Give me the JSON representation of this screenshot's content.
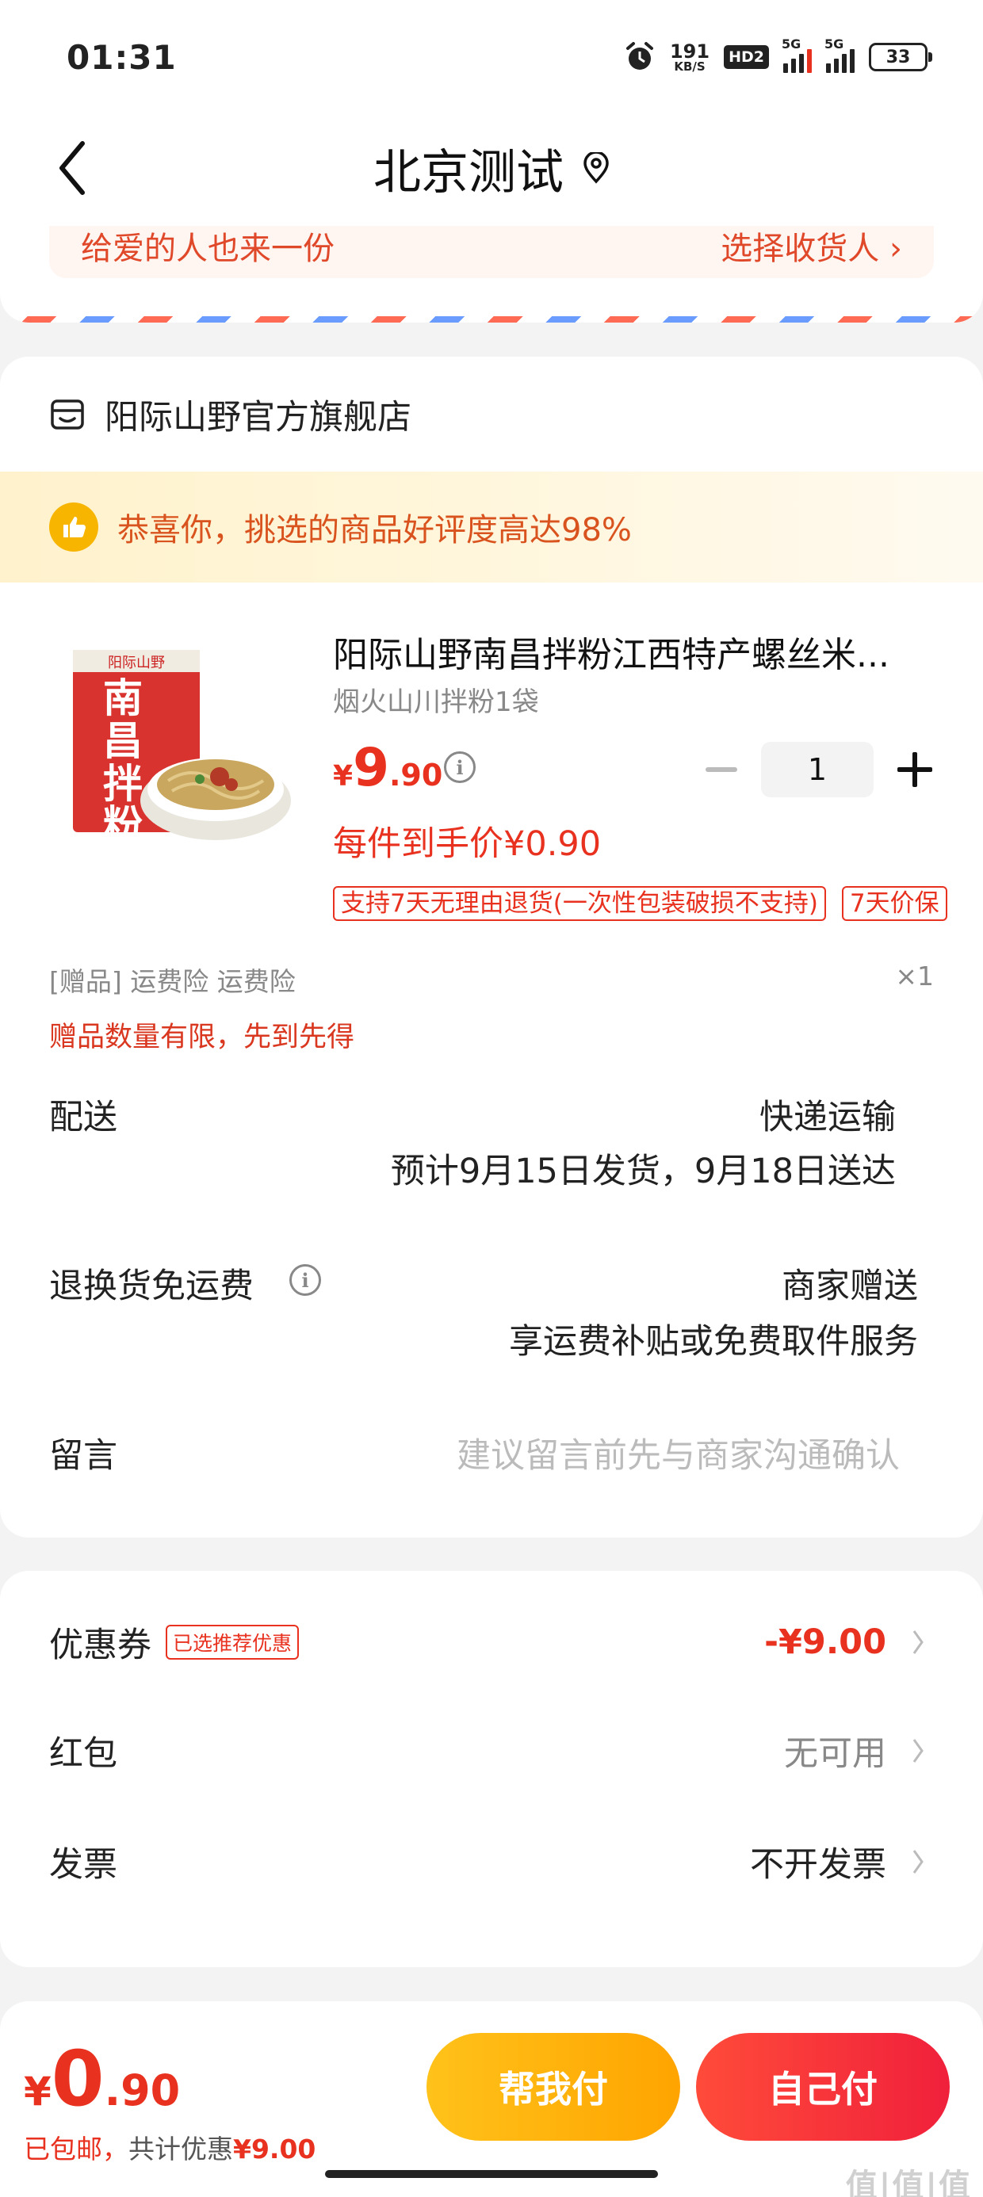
{
  "status": {
    "time": "01:31",
    "net_speed_value": "191",
    "net_speed_unit": "KB/S",
    "hd_label": "HD2",
    "signal1_label": "5G",
    "signal2_label": "5G",
    "battery": "33"
  },
  "nav": {
    "title": "北京测试"
  },
  "address": {
    "left_text": "给爱的人也来一份",
    "right_text": "选择收货人 ›"
  },
  "shop": {
    "name": "阳际山野官方旗舰店",
    "praise_text": "恭喜你，挑选的商品好评度高达98%"
  },
  "product": {
    "title": "阳际山野南昌拌粉江西特产螺丝米...",
    "spec": "烟火山川拌粉1袋",
    "price_currency": "¥",
    "price_int": "9",
    "price_dec": ".90",
    "quantity": "1",
    "each_price": "每件到手价¥0.90",
    "tags": [
      "支持7天无理由退货(一次性包装破损不支持)",
      "7天价保"
    ],
    "package_text": "南昌拌粉",
    "brand_mark": "阳际山野"
  },
  "gift": {
    "label": "[赠品]  运费险 运费险",
    "count": "×1",
    "note": "赠品数量有限，先到先得"
  },
  "delivery": {
    "label": "配送",
    "method": "快递运输",
    "estimate": "预计9月15日发货，9月18日送达"
  },
  "return_shipping": {
    "label": "退换货免运费",
    "value": "商家赠送",
    "desc": "享运费补贴或免费取件服务"
  },
  "message": {
    "label": "留言",
    "placeholder": "建议留言前先与商家沟通确认"
  },
  "coupon": {
    "label": "优惠券",
    "badge": "已选推荐优惠",
    "value": "-¥9.00"
  },
  "red_packet": {
    "label": "红包",
    "value": "无可用"
  },
  "invoice": {
    "label": "发票",
    "value": "不开发票"
  },
  "bottom": {
    "currency": "¥",
    "total_int": "0",
    "total_dec": ".90",
    "shipping_text": "已包邮，",
    "discount_prefix": "共计优惠",
    "discount_value": "¥9.00",
    "help_pay": "帮我付",
    "self_pay": "自己付"
  },
  "watermark": "值|值|值",
  "colors": {
    "accent": "#e8311f",
    "praise": "#d9531e",
    "help_button": "#ffb000",
    "self_button": "#f0303b"
  }
}
